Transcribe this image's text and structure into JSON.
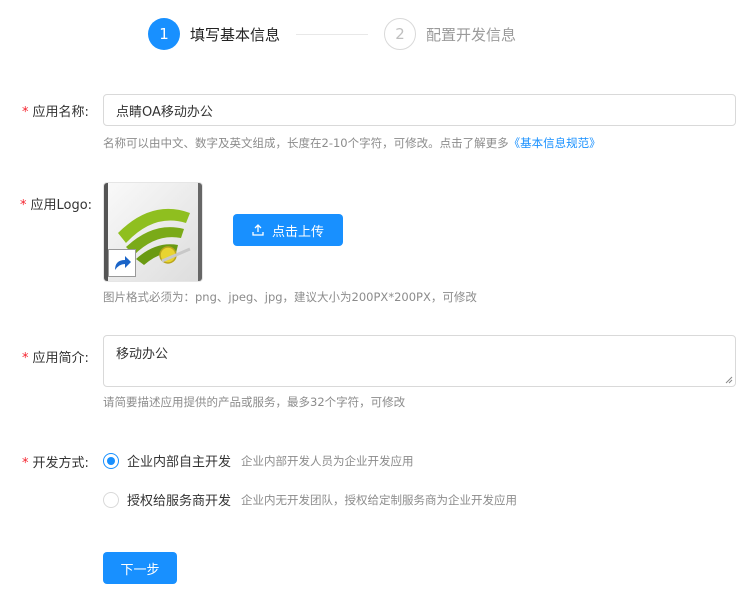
{
  "steps": [
    {
      "number": "1",
      "title": "填写基本信息",
      "active": true
    },
    {
      "number": "2",
      "title": "配置开发信息",
      "active": false
    }
  ],
  "form": {
    "name": {
      "label": "应用名称:",
      "value": "点睛OA移动办公",
      "help_prefix": "名称可以由中文、数字及英文组成，长度在2-10个字符，可修改。点击了解更多",
      "help_link": "《基本信息规范》"
    },
    "logo": {
      "label": "应用Logo:",
      "upload_label": "点击上传",
      "help": "图片格式必须为：png、jpeg、jpg，建议大小为200PX*200PX，可修改"
    },
    "intro": {
      "label": "应用简介:",
      "value": "移动办公",
      "help": "请简要描述应用提供的产品或服务，最多32个字符，可修改"
    },
    "dev_mode": {
      "label": "开发方式:",
      "options": [
        {
          "label": "企业内部自主开发",
          "desc": "企业内部开发人员为企业开发应用",
          "checked": true
        },
        {
          "label": "授权给服务商开发",
          "desc": "企业内无开发团队，授权给定制服务商为企业开发应用",
          "checked": false
        }
      ]
    },
    "next_label": "下一步"
  },
  "colors": {
    "primary": "#1890ff",
    "required": "#f5222d",
    "help_text": "#8c8c8c",
    "border": "#d9d9d9"
  },
  "icons": {
    "upload": "upload-icon",
    "logo": "wifi-signal-logo-icon",
    "shortcut": "shortcut-arrow-icon"
  }
}
